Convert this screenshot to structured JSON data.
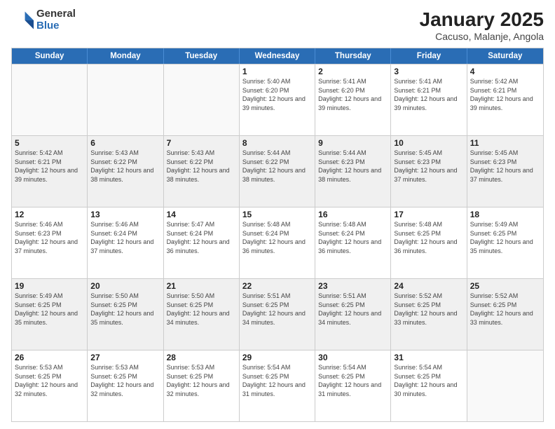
{
  "logo": {
    "general": "General",
    "blue": "Blue"
  },
  "title": "January 2025",
  "subtitle": "Cacuso, Malanje, Angola",
  "days_of_week": [
    "Sunday",
    "Monday",
    "Tuesday",
    "Wednesday",
    "Thursday",
    "Friday",
    "Saturday"
  ],
  "weeks": [
    [
      {
        "day": "",
        "empty": true
      },
      {
        "day": "",
        "empty": true
      },
      {
        "day": "",
        "empty": true
      },
      {
        "day": "1",
        "sunrise": "5:40 AM",
        "sunset": "6:20 PM",
        "daylight": "12 hours and 39 minutes."
      },
      {
        "day": "2",
        "sunrise": "5:41 AM",
        "sunset": "6:20 PM",
        "daylight": "12 hours and 39 minutes."
      },
      {
        "day": "3",
        "sunrise": "5:41 AM",
        "sunset": "6:21 PM",
        "daylight": "12 hours and 39 minutes."
      },
      {
        "day": "4",
        "sunrise": "5:42 AM",
        "sunset": "6:21 PM",
        "daylight": "12 hours and 39 minutes."
      }
    ],
    [
      {
        "day": "5",
        "sunrise": "5:42 AM",
        "sunset": "6:21 PM",
        "daylight": "12 hours and 39 minutes."
      },
      {
        "day": "6",
        "sunrise": "5:43 AM",
        "sunset": "6:22 PM",
        "daylight": "12 hours and 38 minutes."
      },
      {
        "day": "7",
        "sunrise": "5:43 AM",
        "sunset": "6:22 PM",
        "daylight": "12 hours and 38 minutes."
      },
      {
        "day": "8",
        "sunrise": "5:44 AM",
        "sunset": "6:22 PM",
        "daylight": "12 hours and 38 minutes."
      },
      {
        "day": "9",
        "sunrise": "5:44 AM",
        "sunset": "6:23 PM",
        "daylight": "12 hours and 38 minutes."
      },
      {
        "day": "10",
        "sunrise": "5:45 AM",
        "sunset": "6:23 PM",
        "daylight": "12 hours and 37 minutes."
      },
      {
        "day": "11",
        "sunrise": "5:45 AM",
        "sunset": "6:23 PM",
        "daylight": "12 hours and 37 minutes."
      }
    ],
    [
      {
        "day": "12",
        "sunrise": "5:46 AM",
        "sunset": "6:23 PM",
        "daylight": "12 hours and 37 minutes."
      },
      {
        "day": "13",
        "sunrise": "5:46 AM",
        "sunset": "6:24 PM",
        "daylight": "12 hours and 37 minutes."
      },
      {
        "day": "14",
        "sunrise": "5:47 AM",
        "sunset": "6:24 PM",
        "daylight": "12 hours and 36 minutes."
      },
      {
        "day": "15",
        "sunrise": "5:48 AM",
        "sunset": "6:24 PM",
        "daylight": "12 hours and 36 minutes."
      },
      {
        "day": "16",
        "sunrise": "5:48 AM",
        "sunset": "6:24 PM",
        "daylight": "12 hours and 36 minutes."
      },
      {
        "day": "17",
        "sunrise": "5:48 AM",
        "sunset": "6:25 PM",
        "daylight": "12 hours and 36 minutes."
      },
      {
        "day": "18",
        "sunrise": "5:49 AM",
        "sunset": "6:25 PM",
        "daylight": "12 hours and 35 minutes."
      }
    ],
    [
      {
        "day": "19",
        "sunrise": "5:49 AM",
        "sunset": "6:25 PM",
        "daylight": "12 hours and 35 minutes."
      },
      {
        "day": "20",
        "sunrise": "5:50 AM",
        "sunset": "6:25 PM",
        "daylight": "12 hours and 35 minutes."
      },
      {
        "day": "21",
        "sunrise": "5:50 AM",
        "sunset": "6:25 PM",
        "daylight": "12 hours and 34 minutes."
      },
      {
        "day": "22",
        "sunrise": "5:51 AM",
        "sunset": "6:25 PM",
        "daylight": "12 hours and 34 minutes."
      },
      {
        "day": "23",
        "sunrise": "5:51 AM",
        "sunset": "6:25 PM",
        "daylight": "12 hours and 34 minutes."
      },
      {
        "day": "24",
        "sunrise": "5:52 AM",
        "sunset": "6:25 PM",
        "daylight": "12 hours and 33 minutes."
      },
      {
        "day": "25",
        "sunrise": "5:52 AM",
        "sunset": "6:25 PM",
        "daylight": "12 hours and 33 minutes."
      }
    ],
    [
      {
        "day": "26",
        "sunrise": "5:53 AM",
        "sunset": "6:25 PM",
        "daylight": "12 hours and 32 minutes."
      },
      {
        "day": "27",
        "sunrise": "5:53 AM",
        "sunset": "6:25 PM",
        "daylight": "12 hours and 32 minutes."
      },
      {
        "day": "28",
        "sunrise": "5:53 AM",
        "sunset": "6:25 PM",
        "daylight": "12 hours and 32 minutes."
      },
      {
        "day": "29",
        "sunrise": "5:54 AM",
        "sunset": "6:25 PM",
        "daylight": "12 hours and 31 minutes."
      },
      {
        "day": "30",
        "sunrise": "5:54 AM",
        "sunset": "6:25 PM",
        "daylight": "12 hours and 31 minutes."
      },
      {
        "day": "31",
        "sunrise": "5:54 AM",
        "sunset": "6:25 PM",
        "daylight": "12 hours and 30 minutes."
      },
      {
        "day": "",
        "empty": true
      }
    ]
  ]
}
